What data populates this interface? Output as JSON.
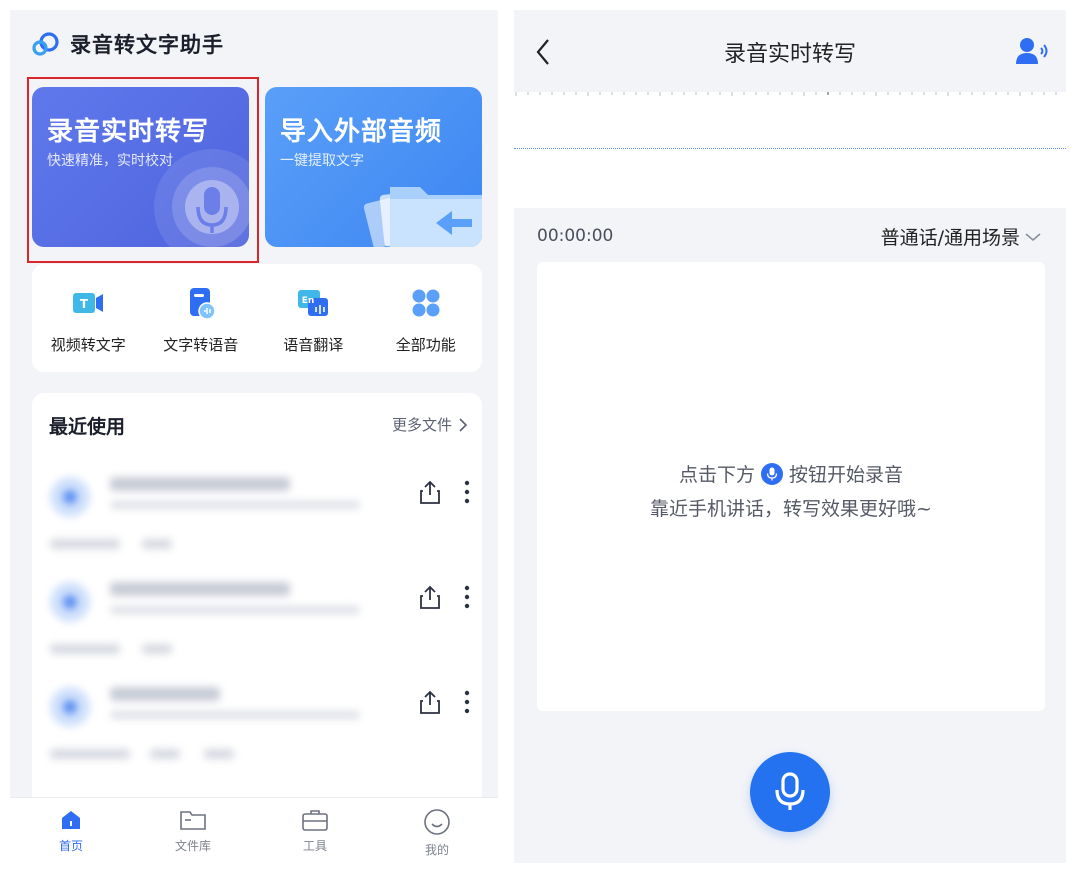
{
  "left_screen": {
    "app_title": "录音转文字助手",
    "cards": {
      "record": {
        "title": "录音实时转写",
        "subtitle": "快速精准，实时校对"
      },
      "import": {
        "title": "导入外部音频",
        "subtitle": "一键提取文字"
      }
    },
    "features": [
      {
        "label": "视频转文字",
        "icon": "video-to-text-icon"
      },
      {
        "label": "文字转语音",
        "icon": "text-to-speech-icon"
      },
      {
        "label": "语音翻译",
        "icon": "voice-translate-icon"
      },
      {
        "label": "全部功能",
        "icon": "all-functions-icon"
      }
    ],
    "recent": {
      "title": "最近使用",
      "more_label": "更多文件"
    },
    "tabs": [
      {
        "label": "首页",
        "icon": "home-icon",
        "active": true
      },
      {
        "label": "文件库",
        "icon": "folder-icon",
        "active": false
      },
      {
        "label": "工具",
        "icon": "toolbox-icon",
        "active": false
      },
      {
        "label": "我的",
        "icon": "profile-icon",
        "active": false
      }
    ]
  },
  "right_screen": {
    "title": "录音实时转写",
    "timer": "00:00:00",
    "scene_selector": "普通话/通用场景",
    "hint_prefix": "点击下方",
    "hint_suffix": "按钮开始录音",
    "hint_line2": "靠近手机讲话，转写效果更好哦~"
  },
  "colors": {
    "accent": "#2f6ef2",
    "record_card": "#5569e0",
    "import_card": "#4a93f5",
    "highlight": "#d9262b"
  }
}
